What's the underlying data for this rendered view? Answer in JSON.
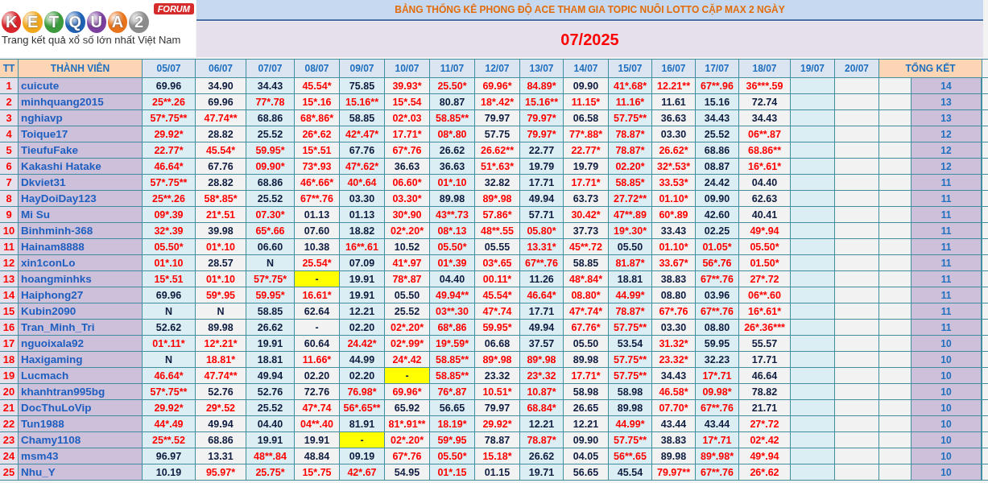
{
  "logo": {
    "letters": [
      {
        "char": "K",
        "color": "#d9262c"
      },
      {
        "char": "E",
        "color": "#f2a81d"
      },
      {
        "char": "T",
        "color": "#3a9a3c"
      },
      {
        "char": "Q",
        "color": "#1f62b5"
      },
      {
        "char": "U",
        "color": "#7b3f9e"
      },
      {
        "char": "A",
        "color": "#e8731b"
      },
      {
        "char": "2",
        "color": "#8c8c8c"
      }
    ],
    "badge": "FORUM",
    "tagline": "Trang kết quả xổ số lớn nhất Việt Nam"
  },
  "title": "BẢNG THỐNG KÊ PHONG ĐỘ ACE THAM GIA TOPIC NUÔI LOTTO CẶP MAX 2 NGÀY",
  "period": "07/2025",
  "columns": {
    "number": "TT",
    "member": "THÀNH VIÊN",
    "dates": [
      "05/07",
      "06/07",
      "07/07",
      "08/07",
      "09/07",
      "10/07",
      "11/07",
      "12/07",
      "13/07",
      "14/07",
      "15/07",
      "16/07",
      "17/07",
      "18/07",
      "19/07",
      "20/07"
    ],
    "total": "TỔNG KẾT"
  },
  "rows": [
    {
      "no": "1",
      "name": "cuicute",
      "total": "14",
      "cells": [
        {
          "v": "69.96",
          "marked": false,
          "highlighted": false
        },
        {
          "v": "34.90",
          "marked": false,
          "highlighted": false
        },
        {
          "v": "34.43",
          "marked": false,
          "highlighted": false
        },
        {
          "v": "45.54*",
          "marked": true,
          "highlighted": false
        },
        {
          "v": "75.85",
          "marked": false,
          "highlighted": false
        },
        {
          "v": "39.93*",
          "marked": true,
          "highlighted": false
        },
        {
          "v": "25.50*",
          "marked": true,
          "highlighted": false
        },
        {
          "v": "69.96*",
          "marked": true,
          "highlighted": false
        },
        {
          "v": "84.89*",
          "marked": true,
          "highlighted": false
        },
        {
          "v": "09.90",
          "marked": false,
          "highlighted": false
        },
        {
          "v": "41*.68*",
          "marked": true,
          "highlighted": false
        },
        {
          "v": "12.21**",
          "marked": true,
          "highlighted": false
        },
        {
          "v": "67**.96",
          "marked": true,
          "highlighted": false
        },
        {
          "v": "36***.59",
          "marked": true,
          "highlighted": false
        }
      ]
    },
    {
      "no": "2",
      "name": "minhquang2015",
      "total": "13",
      "cells": [
        {
          "v": "25**.26",
          "marked": true,
          "highlighted": false
        },
        {
          "v": "69.96",
          "marked": false,
          "highlighted": false
        },
        {
          "v": "77*.78",
          "marked": true,
          "highlighted": false
        },
        {
          "v": "15*.16",
          "marked": true,
          "highlighted": false
        },
        {
          "v": "15.16**",
          "marked": true,
          "highlighted": false
        },
        {
          "v": "15*.54",
          "marked": true,
          "highlighted": false
        },
        {
          "v": "80.87",
          "marked": false,
          "highlighted": false
        },
        {
          "v": "18*.42*",
          "marked": true,
          "highlighted": false
        },
        {
          "v": "15.16**",
          "marked": true,
          "highlighted": false
        },
        {
          "v": "11.15*",
          "marked": true,
          "highlighted": false
        },
        {
          "v": "11.16*",
          "marked": true,
          "highlighted": false
        },
        {
          "v": "11.61",
          "marked": false,
          "highlighted": false
        },
        {
          "v": "15.16",
          "marked": false,
          "highlighted": false
        },
        {
          "v": "72.74",
          "marked": false,
          "highlighted": false
        }
      ]
    },
    {
      "no": "3",
      "name": "nghiavp",
      "total": "13",
      "cells": [
        {
          "v": "57*.75**",
          "marked": true,
          "highlighted": false
        },
        {
          "v": "47.74**",
          "marked": true,
          "highlighted": false
        },
        {
          "v": "68.86",
          "marked": false,
          "highlighted": false
        },
        {
          "v": "68*.86*",
          "marked": true,
          "highlighted": false
        },
        {
          "v": "58.85",
          "marked": false,
          "highlighted": false
        },
        {
          "v": "02*.03",
          "marked": true,
          "highlighted": false
        },
        {
          "v": "58.85**",
          "marked": true,
          "highlighted": false
        },
        {
          "v": "79.97",
          "marked": false,
          "highlighted": false
        },
        {
          "v": "79.97*",
          "marked": true,
          "highlighted": false
        },
        {
          "v": "06.58",
          "marked": false,
          "highlighted": false
        },
        {
          "v": "57.75**",
          "marked": true,
          "highlighted": false
        },
        {
          "v": "36.63",
          "marked": false,
          "highlighted": false
        },
        {
          "v": "34.43",
          "marked": false,
          "highlighted": false
        },
        {
          "v": "34.43",
          "marked": false,
          "highlighted": false
        }
      ]
    },
    {
      "no": "4",
      "name": "Toique17",
      "total": "12",
      "cells": [
        {
          "v": "29.92*",
          "marked": true,
          "highlighted": false
        },
        {
          "v": "28.82",
          "marked": false,
          "highlighted": false
        },
        {
          "v": "25.52",
          "marked": false,
          "highlighted": false
        },
        {
          "v": "26*.62",
          "marked": true,
          "highlighted": false
        },
        {
          "v": "42*.47*",
          "marked": true,
          "highlighted": false
        },
        {
          "v": "17.71*",
          "marked": true,
          "highlighted": false
        },
        {
          "v": "08*.80",
          "marked": true,
          "highlighted": false
        },
        {
          "v": "57.75",
          "marked": false,
          "highlighted": false
        },
        {
          "v": "79.97*",
          "marked": true,
          "highlighted": false
        },
        {
          "v": "77*.88*",
          "marked": true,
          "highlighted": false
        },
        {
          "v": "78.87*",
          "marked": true,
          "highlighted": false
        },
        {
          "v": "03.30",
          "marked": false,
          "highlighted": false
        },
        {
          "v": "25.52",
          "marked": false,
          "highlighted": false
        },
        {
          "v": "06**.87",
          "marked": true,
          "highlighted": false
        }
      ]
    },
    {
      "no": "5",
      "name": "TieufuFake",
      "total": "12",
      "cells": [
        {
          "v": "22.77*",
          "marked": true,
          "highlighted": false
        },
        {
          "v": "45.54*",
          "marked": true,
          "highlighted": false
        },
        {
          "v": "59.95*",
          "marked": true,
          "highlighted": false
        },
        {
          "v": "15*.51",
          "marked": true,
          "highlighted": false
        },
        {
          "v": "67.76",
          "marked": false,
          "highlighted": false
        },
        {
          "v": "67*.76",
          "marked": true,
          "highlighted": false
        },
        {
          "v": "26.62",
          "marked": false,
          "highlighted": false
        },
        {
          "v": "26.62**",
          "marked": true,
          "highlighted": false
        },
        {
          "v": "22.77",
          "marked": false,
          "highlighted": false
        },
        {
          "v": "22.77*",
          "marked": true,
          "highlighted": false
        },
        {
          "v": "78.87*",
          "marked": true,
          "highlighted": false
        },
        {
          "v": "26.62*",
          "marked": true,
          "highlighted": false
        },
        {
          "v": "68.86",
          "marked": false,
          "highlighted": false
        },
        {
          "v": "68.86**",
          "marked": true,
          "highlighted": false
        }
      ]
    },
    {
      "no": "6",
      "name": "Kakashi Hatake",
      "total": "12",
      "cells": [
        {
          "v": "46.64*",
          "marked": true,
          "highlighted": false
        },
        {
          "v": "67.76",
          "marked": false,
          "highlighted": false
        },
        {
          "v": "09.90*",
          "marked": true,
          "highlighted": false
        },
        {
          "v": "73*.93",
          "marked": true,
          "highlighted": false
        },
        {
          "v": "47*.62*",
          "marked": true,
          "highlighted": false
        },
        {
          "v": "36.63",
          "marked": false,
          "highlighted": false
        },
        {
          "v": "36.63",
          "marked": false,
          "highlighted": false
        },
        {
          "v": "51*.63*",
          "marked": true,
          "highlighted": false
        },
        {
          "v": "19.79",
          "marked": false,
          "highlighted": false
        },
        {
          "v": "19.79",
          "marked": false,
          "highlighted": false
        },
        {
          "v": "02.20*",
          "marked": true,
          "highlighted": false
        },
        {
          "v": "32*.53*",
          "marked": true,
          "highlighted": false
        },
        {
          "v": "08.87",
          "marked": false,
          "highlighted": false
        },
        {
          "v": "16*.61*",
          "marked": true,
          "highlighted": false
        }
      ]
    },
    {
      "no": "7",
      "name": "Dkviet31",
      "total": "11",
      "cells": [
        {
          "v": "57*.75**",
          "marked": true,
          "highlighted": false
        },
        {
          "v": "28.82",
          "marked": false,
          "highlighted": false
        },
        {
          "v": "68.86",
          "marked": false,
          "highlighted": false
        },
        {
          "v": "46*.66*",
          "marked": true,
          "highlighted": false
        },
        {
          "v": "40*.64",
          "marked": true,
          "highlighted": false
        },
        {
          "v": "06.60*",
          "marked": true,
          "highlighted": false
        },
        {
          "v": "01*.10",
          "marked": true,
          "highlighted": false
        },
        {
          "v": "32.82",
          "marked": false,
          "highlighted": false
        },
        {
          "v": "17.71",
          "marked": false,
          "highlighted": false
        },
        {
          "v": "17.71*",
          "marked": true,
          "highlighted": false
        },
        {
          "v": "58.85*",
          "marked": true,
          "highlighted": false
        },
        {
          "v": "33.53*",
          "marked": true,
          "highlighted": false
        },
        {
          "v": "24.42",
          "marked": false,
          "highlighted": false
        },
        {
          "v": "04.40",
          "marked": false,
          "highlighted": false
        }
      ]
    },
    {
      "no": "8",
      "name": "HayDoiDay123",
      "total": "11",
      "cells": [
        {
          "v": "25**.26",
          "marked": true,
          "highlighted": false
        },
        {
          "v": "58*.85*",
          "marked": true,
          "highlighted": false
        },
        {
          "v": "25.52",
          "marked": false,
          "highlighted": false
        },
        {
          "v": "67**.76",
          "marked": true,
          "highlighted": false
        },
        {
          "v": "03.30",
          "marked": false,
          "highlighted": false
        },
        {
          "v": "03.30*",
          "marked": true,
          "highlighted": false
        },
        {
          "v": "89.98",
          "marked": false,
          "highlighted": false
        },
        {
          "v": "89*.98",
          "marked": true,
          "highlighted": false
        },
        {
          "v": "49.94",
          "marked": false,
          "highlighted": false
        },
        {
          "v": "63.73",
          "marked": false,
          "highlighted": false
        },
        {
          "v": "27.72**",
          "marked": true,
          "highlighted": false
        },
        {
          "v": "01.10*",
          "marked": true,
          "highlighted": false
        },
        {
          "v": "09.90",
          "marked": false,
          "highlighted": false
        },
        {
          "v": "62.63",
          "marked": false,
          "highlighted": false
        }
      ]
    },
    {
      "no": "9",
      "name": "Mi Su",
      "total": "11",
      "cells": [
        {
          "v": "09*.39",
          "marked": true,
          "highlighted": false
        },
        {
          "v": "21*.51",
          "marked": true,
          "highlighted": false
        },
        {
          "v": "07.30*",
          "marked": true,
          "highlighted": false
        },
        {
          "v": "01.13",
          "marked": false,
          "highlighted": false
        },
        {
          "v": "01.13",
          "marked": false,
          "highlighted": false
        },
        {
          "v": "30*.90",
          "marked": true,
          "highlighted": false
        },
        {
          "v": "43**.73",
          "marked": true,
          "highlighted": false
        },
        {
          "v": "57.86*",
          "marked": true,
          "highlighted": false
        },
        {
          "v": "57.71",
          "marked": false,
          "highlighted": false
        },
        {
          "v": "30.42*",
          "marked": true,
          "highlighted": false
        },
        {
          "v": "47**.89",
          "marked": true,
          "highlighted": false
        },
        {
          "v": "60*.89",
          "marked": true,
          "highlighted": false
        },
        {
          "v": "42.60",
          "marked": false,
          "highlighted": false
        },
        {
          "v": "40.41",
          "marked": false,
          "highlighted": false
        }
      ]
    },
    {
      "no": "10",
      "name": "Binhminh-368",
      "total": "11",
      "cells": [
        {
          "v": "32*.39",
          "marked": true,
          "highlighted": false
        },
        {
          "v": "39.98",
          "marked": false,
          "highlighted": false
        },
        {
          "v": "65*.66",
          "marked": true,
          "highlighted": false
        },
        {
          "v": "07.60",
          "marked": false,
          "highlighted": false
        },
        {
          "v": "18.82",
          "marked": false,
          "highlighted": false
        },
        {
          "v": "02*.20*",
          "marked": true,
          "highlighted": false
        },
        {
          "v": "08*.13",
          "marked": true,
          "highlighted": false
        },
        {
          "v": "48**.55",
          "marked": true,
          "highlighted": false
        },
        {
          "v": "05.80*",
          "marked": true,
          "highlighted": false
        },
        {
          "v": "37.73",
          "marked": false,
          "highlighted": false
        },
        {
          "v": "19*.30*",
          "marked": true,
          "highlighted": false
        },
        {
          "v": "33.43",
          "marked": false,
          "highlighted": false
        },
        {
          "v": "02.25",
          "marked": false,
          "highlighted": false
        },
        {
          "v": "49*.94",
          "marked": true,
          "highlighted": false
        }
      ]
    },
    {
      "no": "11",
      "name": "Hainam8888",
      "total": "11",
      "cells": [
        {
          "v": "05.50*",
          "marked": true,
          "highlighted": false
        },
        {
          "v": "01*.10",
          "marked": true,
          "highlighted": false
        },
        {
          "v": "06.60",
          "marked": false,
          "highlighted": false
        },
        {
          "v": "10.38",
          "marked": false,
          "highlighted": false
        },
        {
          "v": "16**.61",
          "marked": true,
          "highlighted": false
        },
        {
          "v": "10.52",
          "marked": false,
          "highlighted": false
        },
        {
          "v": "05.50*",
          "marked": true,
          "highlighted": false
        },
        {
          "v": "05.55",
          "marked": false,
          "highlighted": false
        },
        {
          "v": "13.31*",
          "marked": true,
          "highlighted": false
        },
        {
          "v": "45**.72",
          "marked": true,
          "highlighted": false
        },
        {
          "v": "05.50",
          "marked": false,
          "highlighted": false
        },
        {
          "v": "01.10*",
          "marked": true,
          "highlighted": false
        },
        {
          "v": "01.05*",
          "marked": true,
          "highlighted": false
        },
        {
          "v": "05.50*",
          "marked": true,
          "highlighted": false
        }
      ]
    },
    {
      "no": "12",
      "name": "xin1conLo",
      "total": "11",
      "cells": [
        {
          "v": "01*.10",
          "marked": true,
          "highlighted": false
        },
        {
          "v": "28.57",
          "marked": false,
          "highlighted": false
        },
        {
          "v": "N",
          "marked": false,
          "highlighted": false
        },
        {
          "v": "25.54*",
          "marked": true,
          "highlighted": false
        },
        {
          "v": "07.09",
          "marked": false,
          "highlighted": false
        },
        {
          "v": "41*.97",
          "marked": true,
          "highlighted": false
        },
        {
          "v": "01*.39",
          "marked": true,
          "highlighted": false
        },
        {
          "v": "03*.65",
          "marked": true,
          "highlighted": false
        },
        {
          "v": "67**.76",
          "marked": true,
          "highlighted": false
        },
        {
          "v": "58.85",
          "marked": false,
          "highlighted": false
        },
        {
          "v": "81.87*",
          "marked": true,
          "highlighted": false
        },
        {
          "v": "33.67*",
          "marked": true,
          "highlighted": false
        },
        {
          "v": "56*.76",
          "marked": true,
          "highlighted": false
        },
        {
          "v": "01.50*",
          "marked": true,
          "highlighted": false
        }
      ]
    },
    {
      "no": "13",
      "name": "hoangminhks",
      "total": "11",
      "cells": [
        {
          "v": "15*.51",
          "marked": true,
          "highlighted": false
        },
        {
          "v": "01*.10",
          "marked": true,
          "highlighted": false
        },
        {
          "v": "57*.75*",
          "marked": true,
          "highlighted": false
        },
        {
          "v": "-",
          "marked": false,
          "highlighted": true
        },
        {
          "v": "19.91",
          "marked": false,
          "highlighted": false
        },
        {
          "v": "78*.87",
          "marked": true,
          "highlighted": false
        },
        {
          "v": "04.40",
          "marked": false,
          "highlighted": false
        },
        {
          "v": "00.11*",
          "marked": true,
          "highlighted": false
        },
        {
          "v": "11.26",
          "marked": false,
          "highlighted": false
        },
        {
          "v": "48*.84*",
          "marked": true,
          "highlighted": false
        },
        {
          "v": "18.81",
          "marked": false,
          "highlighted": false
        },
        {
          "v": "38.83",
          "marked": false,
          "highlighted": false
        },
        {
          "v": "67**.76",
          "marked": true,
          "highlighted": false
        },
        {
          "v": "27*.72",
          "marked": true,
          "highlighted": false
        }
      ]
    },
    {
      "no": "14",
      "name": "Haiphong27",
      "total": "11",
      "cells": [
        {
          "v": "69.96",
          "marked": false,
          "highlighted": false
        },
        {
          "v": "59*.95",
          "marked": true,
          "highlighted": false
        },
        {
          "v": "59.95*",
          "marked": true,
          "highlighted": false
        },
        {
          "v": "16.61*",
          "marked": true,
          "highlighted": false
        },
        {
          "v": "19.91",
          "marked": false,
          "highlighted": false
        },
        {
          "v": "05.50",
          "marked": false,
          "highlighted": false
        },
        {
          "v": "49.94**",
          "marked": true,
          "highlighted": false
        },
        {
          "v": "45.54*",
          "marked": true,
          "highlighted": false
        },
        {
          "v": "46.64*",
          "marked": true,
          "highlighted": false
        },
        {
          "v": "08.80*",
          "marked": true,
          "highlighted": false
        },
        {
          "v": "44.99*",
          "marked": true,
          "highlighted": false
        },
        {
          "v": "08.80",
          "marked": false,
          "highlighted": false
        },
        {
          "v": "03.96",
          "marked": false,
          "highlighted": false
        },
        {
          "v": "06**.60",
          "marked": true,
          "highlighted": false
        }
      ]
    },
    {
      "no": "15",
      "name": "Kubin2090",
      "total": "11",
      "cells": [
        {
          "v": "N",
          "marked": false,
          "highlighted": false
        },
        {
          "v": "N",
          "marked": false,
          "highlighted": false
        },
        {
          "v": "58.85",
          "marked": false,
          "highlighted": false
        },
        {
          "v": "62.64",
          "marked": false,
          "highlighted": false
        },
        {
          "v": "12.21",
          "marked": false,
          "highlighted": false
        },
        {
          "v": "25.52",
          "marked": false,
          "highlighted": false
        },
        {
          "v": "03**.30",
          "marked": true,
          "highlighted": false
        },
        {
          "v": "47*.74",
          "marked": true,
          "highlighted": false
        },
        {
          "v": "17.71",
          "marked": false,
          "highlighted": false
        },
        {
          "v": "47*.74*",
          "marked": true,
          "highlighted": false
        },
        {
          "v": "78.87*",
          "marked": true,
          "highlighted": false
        },
        {
          "v": "67*.76",
          "marked": true,
          "highlighted": false
        },
        {
          "v": "67**.76",
          "marked": true,
          "highlighted": false
        },
        {
          "v": "16*.61*",
          "marked": true,
          "highlighted": false
        }
      ]
    },
    {
      "no": "16",
      "name": "Tran_Minh_Tri",
      "total": "11",
      "cells": [
        {
          "v": "52.62",
          "marked": false,
          "highlighted": false
        },
        {
          "v": "89.98",
          "marked": false,
          "highlighted": false
        },
        {
          "v": "26.62",
          "marked": false,
          "highlighted": false
        },
        {
          "v": "-",
          "marked": false,
          "highlighted": false
        },
        {
          "v": "02.20",
          "marked": false,
          "highlighted": false
        },
        {
          "v": "02*.20*",
          "marked": true,
          "highlighted": false
        },
        {
          "v": "68*.86",
          "marked": true,
          "highlighted": false
        },
        {
          "v": "59.95*",
          "marked": true,
          "highlighted": false
        },
        {
          "v": "49.94",
          "marked": false,
          "highlighted": false
        },
        {
          "v": "67.76*",
          "marked": true,
          "highlighted": false
        },
        {
          "v": "57.75**",
          "marked": true,
          "highlighted": false
        },
        {
          "v": "03.30",
          "marked": false,
          "highlighted": false
        },
        {
          "v": "08.80",
          "marked": false,
          "highlighted": false
        },
        {
          "v": "26*.36***",
          "marked": true,
          "highlighted": false
        }
      ]
    },
    {
      "no": "17",
      "name": "nguoixala92",
      "total": "10",
      "cells": [
        {
          "v": "01*.11*",
          "marked": true,
          "highlighted": false
        },
        {
          "v": "12*.21*",
          "marked": true,
          "highlighted": false
        },
        {
          "v": "19.91",
          "marked": false,
          "highlighted": false
        },
        {
          "v": "60.64",
          "marked": false,
          "highlighted": false
        },
        {
          "v": "24.42*",
          "marked": true,
          "highlighted": false
        },
        {
          "v": "02*.99*",
          "marked": true,
          "highlighted": false
        },
        {
          "v": "19*.59*",
          "marked": true,
          "highlighted": false
        },
        {
          "v": "06.68",
          "marked": false,
          "highlighted": false
        },
        {
          "v": "37.57",
          "marked": false,
          "highlighted": false
        },
        {
          "v": "05.50",
          "marked": false,
          "highlighted": false
        },
        {
          "v": "53.54",
          "marked": false,
          "highlighted": false
        },
        {
          "v": "31.32*",
          "marked": true,
          "highlighted": false
        },
        {
          "v": "59.95",
          "marked": false,
          "highlighted": false
        },
        {
          "v": "55.57",
          "marked": false,
          "highlighted": false
        }
      ]
    },
    {
      "no": "18",
      "name": "Haxigaming",
      "total": "10",
      "cells": [
        {
          "v": "N",
          "marked": false,
          "highlighted": false
        },
        {
          "v": "18.81*",
          "marked": true,
          "highlighted": false
        },
        {
          "v": "18.81",
          "marked": false,
          "highlighted": false
        },
        {
          "v": "11.66*",
          "marked": true,
          "highlighted": false
        },
        {
          "v": "44.99",
          "marked": false,
          "highlighted": false
        },
        {
          "v": "24*.42",
          "marked": true,
          "highlighted": false
        },
        {
          "v": "58.85**",
          "marked": true,
          "highlighted": false
        },
        {
          "v": "89*.98",
          "marked": true,
          "highlighted": false
        },
        {
          "v": "89*.98",
          "marked": true,
          "highlighted": false
        },
        {
          "v": "89.98",
          "marked": false,
          "highlighted": false
        },
        {
          "v": "57.75**",
          "marked": true,
          "highlighted": false
        },
        {
          "v": "23.32*",
          "marked": true,
          "highlighted": false
        },
        {
          "v": "32.23",
          "marked": false,
          "highlighted": false
        },
        {
          "v": "17.71",
          "marked": false,
          "highlighted": false
        }
      ]
    },
    {
      "no": "19",
      "name": "Lucmach",
      "total": "10",
      "cells": [
        {
          "v": "46.64*",
          "marked": true,
          "highlighted": false
        },
        {
          "v": "47.74**",
          "marked": true,
          "highlighted": false
        },
        {
          "v": "49.94",
          "marked": false,
          "highlighted": false
        },
        {
          "v": "02.20",
          "marked": false,
          "highlighted": false
        },
        {
          "v": "02.20",
          "marked": false,
          "highlighted": false
        },
        {
          "v": "-",
          "marked": false,
          "highlighted": true
        },
        {
          "v": "58.85**",
          "marked": true,
          "highlighted": false
        },
        {
          "v": "23.32",
          "marked": false,
          "highlighted": false
        },
        {
          "v": "23*.32",
          "marked": true,
          "highlighted": false
        },
        {
          "v": "17.71*",
          "marked": true,
          "highlighted": false
        },
        {
          "v": "57.75**",
          "marked": true,
          "highlighted": false
        },
        {
          "v": "34.43",
          "marked": false,
          "highlighted": false
        },
        {
          "v": "17*.71",
          "marked": true,
          "highlighted": false
        },
        {
          "v": "46.64",
          "marked": false,
          "highlighted": false
        }
      ]
    },
    {
      "no": "20",
      "name": "khanhtran995bg",
      "total": "10",
      "cells": [
        {
          "v": "57*.75**",
          "marked": true,
          "highlighted": false
        },
        {
          "v": "52.76",
          "marked": false,
          "highlighted": false
        },
        {
          "v": "52.76",
          "marked": false,
          "highlighted": false
        },
        {
          "v": "72.76",
          "marked": false,
          "highlighted": false
        },
        {
          "v": "76.98*",
          "marked": true,
          "highlighted": false
        },
        {
          "v": "69.96*",
          "marked": true,
          "highlighted": false
        },
        {
          "v": "76*.87",
          "marked": true,
          "highlighted": false
        },
        {
          "v": "10.51*",
          "marked": true,
          "highlighted": false
        },
        {
          "v": "10.87*",
          "marked": true,
          "highlighted": false
        },
        {
          "v": "58.98",
          "marked": false,
          "highlighted": false
        },
        {
          "v": "58.98",
          "marked": false,
          "highlighted": false
        },
        {
          "v": "46.58*",
          "marked": true,
          "highlighted": false
        },
        {
          "v": "09.98*",
          "marked": true,
          "highlighted": false
        },
        {
          "v": "78.82",
          "marked": false,
          "highlighted": false
        }
      ]
    },
    {
      "no": "21",
      "name": "DocThuLoVip",
      "total": "10",
      "cells": [
        {
          "v": "29.92*",
          "marked": true,
          "highlighted": false
        },
        {
          "v": "29*.52",
          "marked": true,
          "highlighted": false
        },
        {
          "v": "25.52",
          "marked": false,
          "highlighted": false
        },
        {
          "v": "47*.74",
          "marked": true,
          "highlighted": false
        },
        {
          "v": "56*.65**",
          "marked": true,
          "highlighted": false
        },
        {
          "v": "65.92",
          "marked": false,
          "highlighted": false
        },
        {
          "v": "56.65",
          "marked": false,
          "highlighted": false
        },
        {
          "v": "79.97",
          "marked": false,
          "highlighted": false
        },
        {
          "v": "68.84*",
          "marked": true,
          "highlighted": false
        },
        {
          "v": "26.65",
          "marked": false,
          "highlighted": false
        },
        {
          "v": "89.98",
          "marked": false,
          "highlighted": false
        },
        {
          "v": "07.70*",
          "marked": true,
          "highlighted": false
        },
        {
          "v": "67**.76",
          "marked": true,
          "highlighted": false
        },
        {
          "v": "21.71",
          "marked": false,
          "highlighted": false
        }
      ]
    },
    {
      "no": "22",
      "name": "Tun1988",
      "total": "10",
      "cells": [
        {
          "v": "44*.49",
          "marked": true,
          "highlighted": false
        },
        {
          "v": "49.94",
          "marked": false,
          "highlighted": false
        },
        {
          "v": "04.40",
          "marked": false,
          "highlighted": false
        },
        {
          "v": "04**.40",
          "marked": true,
          "highlighted": false
        },
        {
          "v": "81.91",
          "marked": false,
          "highlighted": false
        },
        {
          "v": "81*.91**",
          "marked": true,
          "highlighted": false
        },
        {
          "v": "18.19*",
          "marked": true,
          "highlighted": false
        },
        {
          "v": "29.92*",
          "marked": true,
          "highlighted": false
        },
        {
          "v": "12.21",
          "marked": false,
          "highlighted": false
        },
        {
          "v": "12.21",
          "marked": false,
          "highlighted": false
        },
        {
          "v": "44.99*",
          "marked": true,
          "highlighted": false
        },
        {
          "v": "43.44",
          "marked": false,
          "highlighted": false
        },
        {
          "v": "43.44",
          "marked": false,
          "highlighted": false
        },
        {
          "v": "27*.72",
          "marked": true,
          "highlighted": false
        }
      ]
    },
    {
      "no": "23",
      "name": "Chamy1108",
      "total": "10",
      "cells": [
        {
          "v": "25**.52",
          "marked": true,
          "highlighted": false
        },
        {
          "v": "68.86",
          "marked": false,
          "highlighted": false
        },
        {
          "v": "19.91",
          "marked": false,
          "highlighted": false
        },
        {
          "v": "19.91",
          "marked": false,
          "highlighted": false
        },
        {
          "v": "-",
          "marked": false,
          "highlighted": true
        },
        {
          "v": "02*.20*",
          "marked": true,
          "highlighted": false
        },
        {
          "v": "59*.95",
          "marked": true,
          "highlighted": false
        },
        {
          "v": "78.87",
          "marked": false,
          "highlighted": false
        },
        {
          "v": "78.87*",
          "marked": true,
          "highlighted": false
        },
        {
          "v": "09.90",
          "marked": false,
          "highlighted": false
        },
        {
          "v": "57.75**",
          "marked": true,
          "highlighted": false
        },
        {
          "v": "38.83",
          "marked": false,
          "highlighted": false
        },
        {
          "v": "17*.71",
          "marked": true,
          "highlighted": false
        },
        {
          "v": "02*.42",
          "marked": true,
          "highlighted": false
        }
      ]
    },
    {
      "no": "24",
      "name": "msm43",
      "total": "10",
      "cells": [
        {
          "v": "96.97",
          "marked": false,
          "highlighted": false
        },
        {
          "v": "13.31",
          "marked": false,
          "highlighted": false
        },
        {
          "v": "48**.84",
          "marked": true,
          "highlighted": false
        },
        {
          "v": "48.84",
          "marked": false,
          "highlighted": false
        },
        {
          "v": "09.19",
          "marked": false,
          "highlighted": false
        },
        {
          "v": "67*.76",
          "marked": true,
          "highlighted": false
        },
        {
          "v": "05.50*",
          "marked": true,
          "highlighted": false
        },
        {
          "v": "15.18*",
          "marked": true,
          "highlighted": false
        },
        {
          "v": "26.62",
          "marked": false,
          "highlighted": false
        },
        {
          "v": "04.05",
          "marked": false,
          "highlighted": false
        },
        {
          "v": "56**.65",
          "marked": true,
          "highlighted": false
        },
        {
          "v": "89.98",
          "marked": false,
          "highlighted": false
        },
        {
          "v": "89*.98*",
          "marked": true,
          "highlighted": false
        },
        {
          "v": "49*.94",
          "marked": true,
          "highlighted": false
        }
      ]
    },
    {
      "no": "25",
      "name": "Nhu_Y",
      "total": "10",
      "cells": [
        {
          "v": "10.19",
          "marked": false,
          "highlighted": false
        },
        {
          "v": "95.97*",
          "marked": true,
          "highlighted": false
        },
        {
          "v": "25.75*",
          "marked": true,
          "highlighted": false
        },
        {
          "v": "15*.75",
          "marked": true,
          "highlighted": false
        },
        {
          "v": "42*.67",
          "marked": true,
          "highlighted": false
        },
        {
          "v": "54.95",
          "marked": false,
          "highlighted": false
        },
        {
          "v": "01*.15",
          "marked": true,
          "highlighted": false
        },
        {
          "v": "01.15",
          "marked": false,
          "highlighted": false
        },
        {
          "v": "19.71",
          "marked": false,
          "highlighted": false
        },
        {
          "v": "56.65",
          "marked": false,
          "highlighted": false
        },
        {
          "v": "45.54",
          "marked": false,
          "highlighted": false
        },
        {
          "v": "79.97**",
          "marked": true,
          "highlighted": false
        },
        {
          "v": "67**.76",
          "marked": true,
          "highlighted": false
        },
        {
          "v": "26*.62",
          "marked": true,
          "highlighted": false
        }
      ]
    }
  ]
}
